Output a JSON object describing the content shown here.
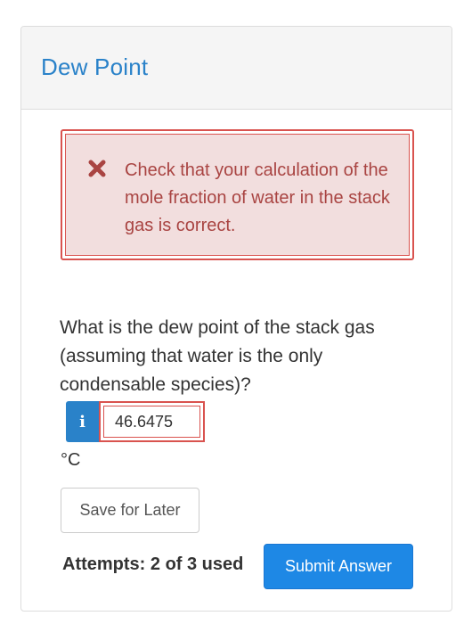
{
  "header": {
    "title": "Dew Point"
  },
  "alert": {
    "icon": "close-icon",
    "message": "Check that your calculation of the mole fraction of water in the stack gas is correct.",
    "color": "#a94442",
    "background": "#f2dede",
    "border_color": "#d9534f"
  },
  "question": {
    "text": "What is the dew point of the stack gas (assuming that water is the only condensable species)?",
    "info_badge": "i",
    "answer_value": "46.6475",
    "unit": "°C"
  },
  "actions": {
    "save_label": "Save for Later",
    "attempts_label": "Attempts: 2 of 3 used",
    "submit_label": "Submit Answer"
  },
  "colors": {
    "accent": "#2a82c9",
    "submit": "#1e88e5",
    "error": "#d9534f"
  }
}
